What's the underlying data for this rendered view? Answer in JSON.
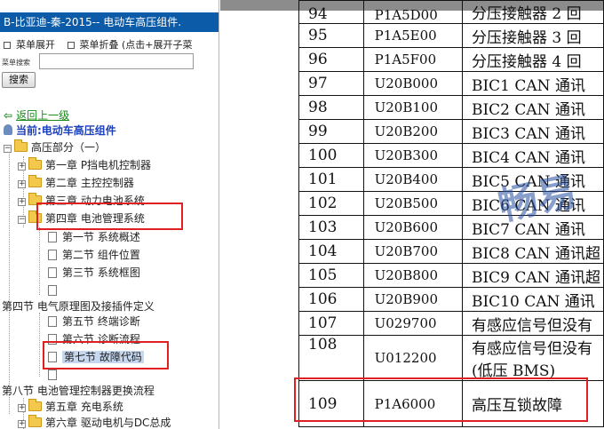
{
  "left_pane": {
    "title": "B-比亚迪-秦-2015-- 电动车高压组件.",
    "menu_expand": "菜单展开",
    "menu_collapse": "菜单折叠 (点击+展开子菜",
    "search_label": "菜单搜索",
    "search_value": "",
    "search_button": "搜索",
    "back_link": "返回上一级",
    "current": "当前:电动车高压组件",
    "tree": {
      "root": "高压部分（一）",
      "ch1": "第一章 P挡电机控制器",
      "ch2": "第二章 主控控制器",
      "ch3": "第三章 动力电池系统",
      "ch4": "第四章 电池管理系统",
      "s1": "第一节 系统概述",
      "s2": "第二节 组件位置",
      "s3": "第三节 系统框图",
      "s4_blank": "",
      "s4": "第四节 电气原理图及接插件定义",
      "s5": "第五节 终端诊断",
      "s6": "第六节 诊断流程",
      "s7": "第七节 故障代码",
      "s7_blank": "",
      "s8": "第八节 电池管理控制器更换流程",
      "ch5": "第五章 充电系统",
      "ch6": "第六章 驱动电机与DC总成"
    }
  },
  "table": {
    "rows": [
      {
        "no": "94",
        "code": "P1A5D00",
        "desc": "分压接触器 2 回"
      },
      {
        "no": "95",
        "code": "P1A5E00",
        "desc": "分压接触器 3 回"
      },
      {
        "no": "96",
        "code": "P1A5F00",
        "desc": "分压接触器 4 回"
      },
      {
        "no": "97",
        "code": "U20B000",
        "desc": "BIC1 CAN 通讯"
      },
      {
        "no": "98",
        "code": "U20B100",
        "desc": "BIC2 CAN 通讯"
      },
      {
        "no": "99",
        "code": "U20B200",
        "desc": "BIC3 CAN 通讯"
      },
      {
        "no": "100",
        "code": "U20B300",
        "desc": "BIC4 CAN 通讯"
      },
      {
        "no": "101",
        "code": "U20B400",
        "desc": "BIC5 CAN 通讯"
      },
      {
        "no": "102",
        "code": "U20B500",
        "desc": "BIC6 CAN 通讯"
      },
      {
        "no": "103",
        "code": "U20B600",
        "desc": "BIC7 CAN 通讯"
      },
      {
        "no": "104",
        "code": "U20B700",
        "desc": "BIC8 CAN 通讯超"
      },
      {
        "no": "105",
        "code": "U20B800",
        "desc": "BIC9 CAN 通讯超"
      },
      {
        "no": "106",
        "code": "U20B900",
        "desc": "BIC10 CAN 通讯"
      },
      {
        "no": "107",
        "code": "U029700",
        "desc": "有感应信号但没有"
      },
      {
        "no": "108",
        "code": "U012200",
        "desc": "有感应信号但没有",
        "desc2": "(低压 BMS)"
      },
      {
        "no": "109",
        "code": "P1A6000",
        "desc": "高压互锁故障"
      }
    ]
  },
  "watermark_text": "畅易",
  "colors": {
    "title_bar": "#0b5ba8",
    "highlight_box": "#e02020",
    "link_green": "#1a8a1a",
    "current_blue": "#1a3fbf"
  }
}
